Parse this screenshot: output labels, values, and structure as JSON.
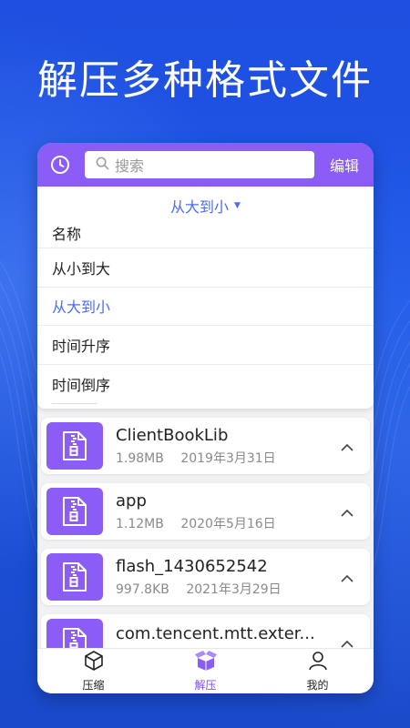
{
  "headline": "解压多种格式文件",
  "topbar": {
    "clock_icon": "clock-icon",
    "search_placeholder": "搜索",
    "edit_label": "编辑"
  },
  "sort": {
    "current": "从大到小",
    "options": [
      {
        "label": "名称",
        "active": false
      },
      {
        "label": "从小到大",
        "active": false
      },
      {
        "label": "从大到小",
        "active": true
      },
      {
        "label": "时间升序",
        "active": false
      },
      {
        "label": "时间倒序",
        "active": false
      }
    ]
  },
  "files": [
    {
      "name": "ClientBookLib",
      "size": "1.98MB",
      "date": "2019年3月31日"
    },
    {
      "name": "app",
      "size": "1.12MB",
      "date": "2020年5月16日"
    },
    {
      "name": "flash_1430652542",
      "size": "997.8KB",
      "date": "2021年3月29日"
    },
    {
      "name": "com.tencent.mtt.exter...",
      "size": "",
      "date": ""
    }
  ],
  "tabs": [
    {
      "label": "压缩",
      "icon": "cube-icon",
      "active": false
    },
    {
      "label": "解压",
      "icon": "open-box-icon",
      "active": true
    },
    {
      "label": "我的",
      "icon": "person-icon",
      "active": false
    }
  ],
  "colors": {
    "accent": "#8b5cf6",
    "sort_active": "#4a6cf7",
    "background": "#1f56d6"
  }
}
